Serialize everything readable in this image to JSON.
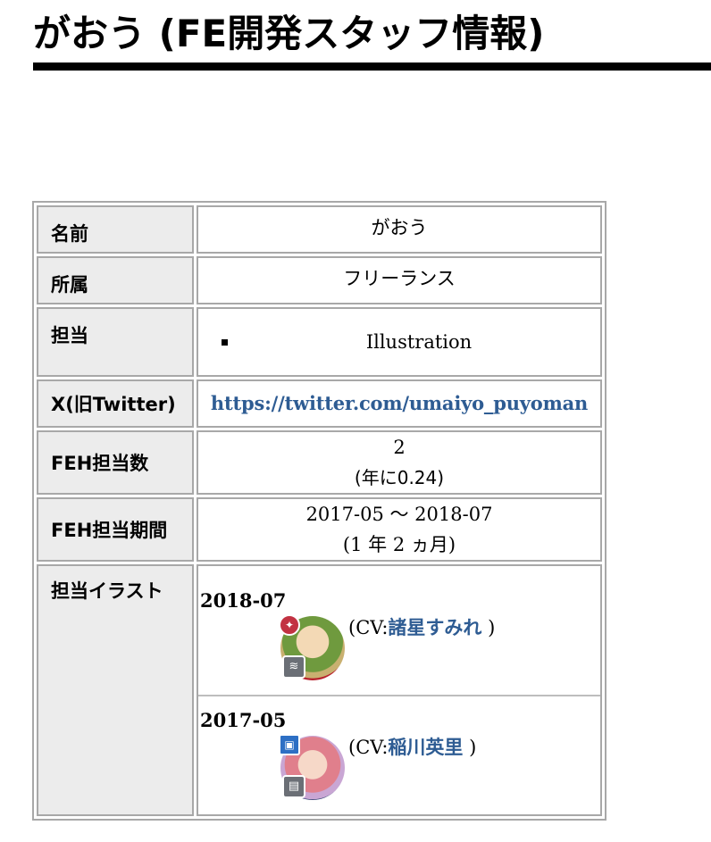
{
  "page": {
    "title": "がおう (FE開発スタッフ情報)"
  },
  "rows": {
    "name": {
      "label": "名前",
      "value": "がおう"
    },
    "affiliation": {
      "label": "所属",
      "value": "フリーランス"
    },
    "role": {
      "label": "担当",
      "items": [
        "Illustration"
      ]
    },
    "x": {
      "label": "X(旧Twitter)",
      "url": "https://twitter.com/umaiyo_puyoman"
    },
    "count": {
      "label": "FEH担当数",
      "value": "2",
      "rate": "(年に0.24)"
    },
    "period": {
      "label": "FEH担当期間",
      "range": "2017-05 〜 2018-07",
      "duration": "(1 年 2 ヵ月)"
    },
    "illustrations": {
      "label": "担当イラスト",
      "entries": [
        {
          "date": "2018-07",
          "cv_prefix": "(CV:",
          "cv_name": "諸星すみれ",
          "cv_suffix": " )",
          "icon_top": "movement-type-icon",
          "icon_bottom": "weapon-type-icon"
        },
        {
          "date": "2017-05",
          "cv_prefix": "(CV:",
          "cv_name": "稲川英里",
          "cv_suffix": " )",
          "icon_top": "movement-type-icon",
          "icon_bottom": "weapon-type-icon"
        }
      ]
    }
  },
  "colors": {
    "link": "#2e5c93",
    "label_bg": "#ececec",
    "border": "#a8a8a8"
  }
}
